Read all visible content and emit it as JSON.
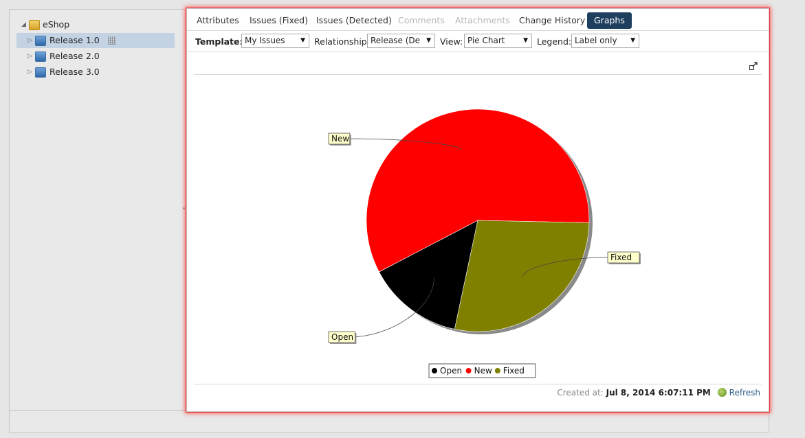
{
  "tree": {
    "root": {
      "label": "eShop"
    },
    "items": [
      {
        "label": "Release 1.0",
        "selected": true
      },
      {
        "label": "Release 2.0",
        "selected": false
      },
      {
        "label": "Release 3.0",
        "selected": false
      }
    ]
  },
  "tabs": [
    {
      "label": "Attributes",
      "state": "normal"
    },
    {
      "label": "Issues (Fixed)",
      "state": "normal"
    },
    {
      "label": "Issues (Detected)",
      "state": "normal"
    },
    {
      "label": "Comments",
      "state": "disabled"
    },
    {
      "label": "Attachments",
      "state": "disabled"
    },
    {
      "label": "Change History",
      "state": "normal"
    },
    {
      "label": "Graphs",
      "state": "active"
    }
  ],
  "toolbar": {
    "template_label": "Template:",
    "template_value": "My Issues",
    "relationship_label": "Relationship:",
    "relationship_value": "Release (De",
    "view_label": "View:",
    "view_value": "Pie Chart",
    "legend_label": "Legend:",
    "legend_value": "Label only"
  },
  "chart_data": {
    "type": "pie",
    "categories": [
      "Open",
      "New",
      "Fixed"
    ],
    "values": [
      14,
      58,
      28
    ],
    "colors": [
      "#000000",
      "#ff0000",
      "#808000"
    ],
    "title": "",
    "legend": "bottom-center"
  },
  "footer": {
    "created_label": "Created at:",
    "created_value": "Jul 8, 2014 6:07:11 PM",
    "refresh_label": "Refresh"
  }
}
